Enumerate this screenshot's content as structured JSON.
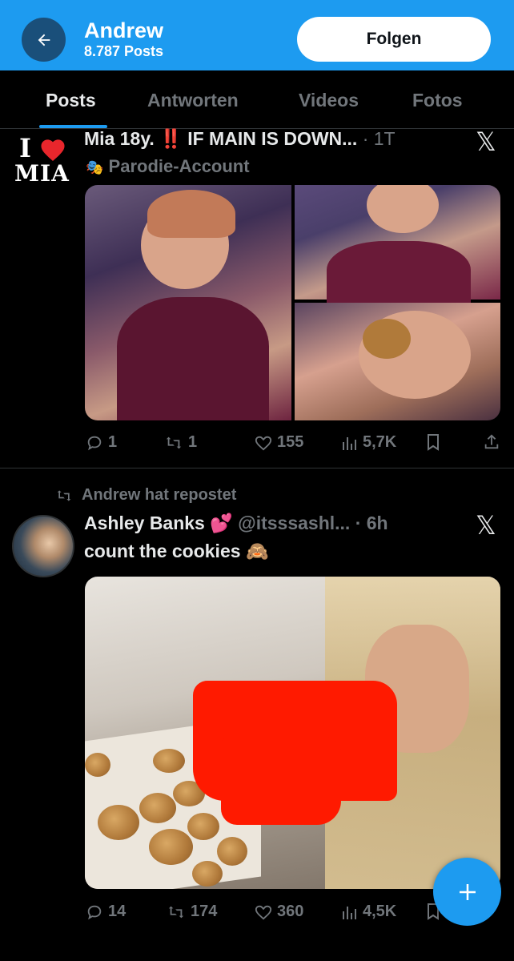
{
  "header": {
    "name": "Andrew",
    "post_count": "8.787 Posts",
    "follow_label": "Folgen"
  },
  "tabs": [
    "Posts",
    "Antworten",
    "Videos",
    "Fotos"
  ],
  "active_tab": "Posts",
  "colors": {
    "accent": "#1d9bf0",
    "background": "#000000",
    "muted": "#71767b",
    "censor": "#ff1a00"
  },
  "post1": {
    "avatar_text_top": "I",
    "avatar_text_bottom": "MIA",
    "display_name": "Mia 18y.",
    "bang": "‼️",
    "headline": "IF MAIN IS DOWN...",
    "time": "· 1T",
    "label": "Parodie-Account",
    "label_icon": "mask-icon",
    "stats": {
      "replies": "1",
      "reposts": "1",
      "likes": "155",
      "views": "5,7K"
    }
  },
  "post2": {
    "repost_label": "Andrew hat repostet",
    "display_name": "Ashley Banks",
    "handle_time": "@itsssashl... · 6h",
    "text": "count the cookies",
    "stats": {
      "replies": "14",
      "reposts": "174",
      "likes": "360",
      "views": "4,5K"
    }
  },
  "icons": [
    "back-arrow-icon",
    "x-logo-icon",
    "reply-icon",
    "repost-icon",
    "like-icon",
    "views-icon",
    "bookmark-icon",
    "share-icon",
    "plus-icon"
  ]
}
